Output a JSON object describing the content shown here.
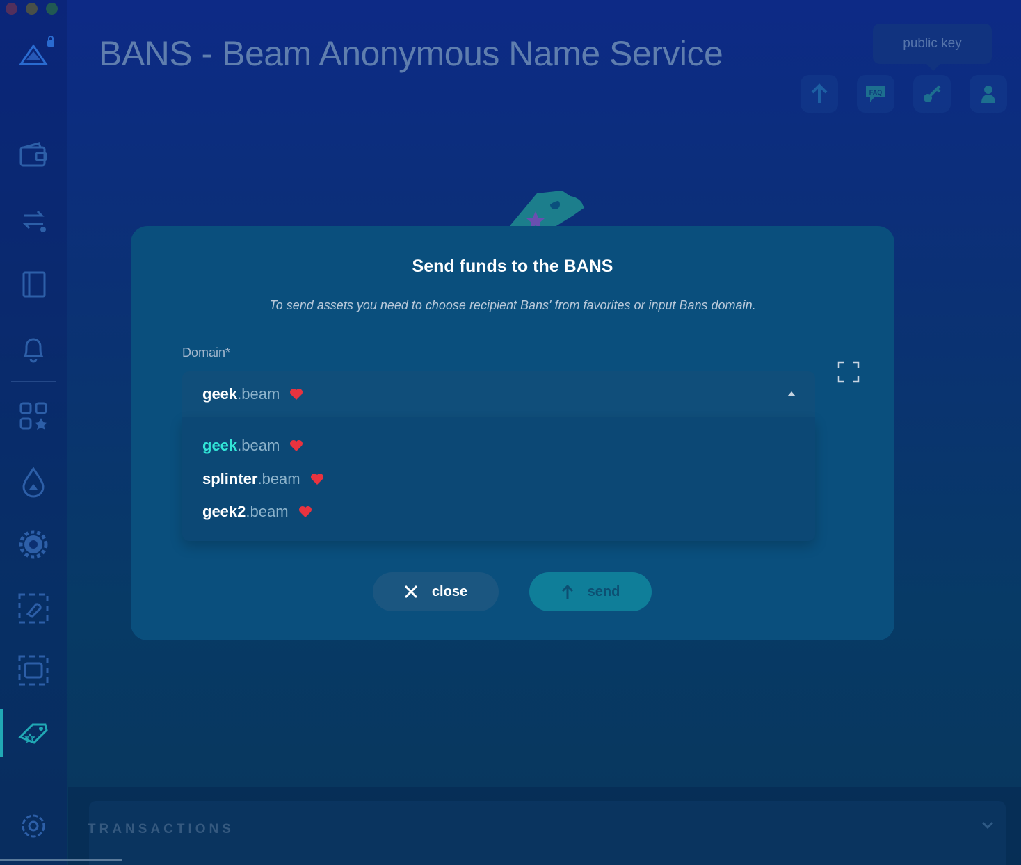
{
  "app": {
    "title": "BANS - Beam Anonymous Name Service",
    "public_key_tooltip": "public key"
  },
  "colors": {
    "accent": "#32e5d7",
    "modal_bg": "#0a4f7d",
    "heart": "#e8333f",
    "send_button": "#0f7e99"
  },
  "sidebar": {
    "items": [
      {
        "icon": "wallet-icon"
      },
      {
        "icon": "swap-icon"
      },
      {
        "icon": "notebook-icon"
      },
      {
        "icon": "bell-icon"
      },
      {
        "icon": "apps-icon"
      },
      {
        "icon": "droplet-icon"
      },
      {
        "icon": "gear-badge-icon"
      },
      {
        "icon": "dapp-icon"
      },
      {
        "icon": "wallet-dapp-icon"
      },
      {
        "icon": "bans-tag-icon"
      },
      {
        "icon": "settings-icon"
      }
    ]
  },
  "header_actions": [
    {
      "icon": "send-arrow-icon"
    },
    {
      "icon": "faq-icon",
      "label": "FAQ"
    },
    {
      "icon": "key-icon"
    },
    {
      "icon": "user-icon"
    }
  ],
  "modal": {
    "title": "Send funds to the BANS",
    "subtitle": "To send assets you need to choose recipient Bans' from favorites or input Bans domain.",
    "domain_label": "Domain*",
    "selected": {
      "name": "geek",
      "tld": ".beam"
    },
    "options": [
      {
        "name": "geek",
        "tld": ".beam",
        "active": true
      },
      {
        "name": "splinter",
        "tld": ".beam",
        "active": false
      },
      {
        "name": "geek2",
        "tld": ".beam",
        "active": false
      }
    ],
    "close_label": "close",
    "send_label": "send"
  },
  "transactions": {
    "title": "TRANSACTIONS"
  }
}
